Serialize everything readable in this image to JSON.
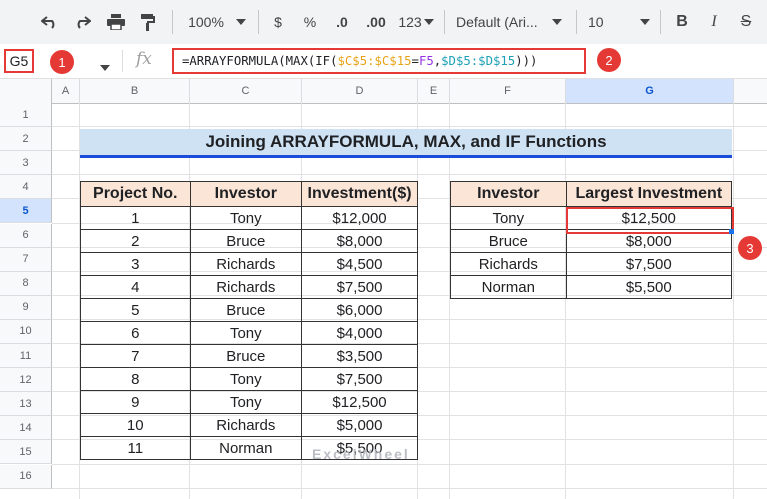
{
  "toolbar": {
    "zoom": "100%",
    "currency": "$",
    "percent": "%",
    "decrease_decimals": ".0",
    "increase_decimals": ".00",
    "more_formats": "123",
    "font": "Default (Ari...",
    "font_size": "10",
    "bold": "B",
    "italic": "I",
    "strikethrough": "S"
  },
  "formula_bar": {
    "cell_ref": "G5",
    "fx": "fx",
    "formula_parts": [
      {
        "text": "=ARRAYFORMULA(MAX(IF(",
        "color": "#202124"
      },
      {
        "text": "$C$5:$C$15",
        "color": "#e8a317"
      },
      {
        "text": "=",
        "color": "#202124"
      },
      {
        "text": "F5",
        "color": "#9334e6"
      },
      {
        "text": ",",
        "color": "#202124"
      },
      {
        "text": "$D$5:$D$15",
        "color": "#1ea0b5"
      },
      {
        "text": ")))",
        "color": "#202124"
      }
    ]
  },
  "badges": [
    "1",
    "2",
    "3"
  ],
  "columns": [
    "A",
    "B",
    "C",
    "D",
    "E",
    "F",
    "G"
  ],
  "rows": [
    "1",
    "2",
    "3",
    "4",
    "5",
    "6",
    "7",
    "8",
    "9",
    "10",
    "11",
    "12",
    "13",
    "14",
    "15",
    "16"
  ],
  "title": "Joining ARRAYFORMULA, MAX, and IF Functions",
  "main_table": {
    "headers": [
      "Project No.",
      "Investor",
      "Investment($)"
    ],
    "rows": [
      [
        "1",
        "Tony",
        "$12,000"
      ],
      [
        "2",
        "Bruce",
        "$8,000"
      ],
      [
        "3",
        "Richards",
        "$4,500"
      ],
      [
        "4",
        "Richards",
        "$7,500"
      ],
      [
        "5",
        "Bruce",
        "$6,000"
      ],
      [
        "6",
        "Tony",
        "$4,000"
      ],
      [
        "7",
        "Bruce",
        "$3,500"
      ],
      [
        "8",
        "Tony",
        "$7,500"
      ],
      [
        "9",
        "Tony",
        "$12,500"
      ],
      [
        "10",
        "Richards",
        "$5,000"
      ],
      [
        "11",
        "Norman",
        "$5,500"
      ]
    ]
  },
  "result_table": {
    "headers": [
      "Investor",
      "Largest Investment"
    ],
    "rows": [
      [
        "Tony",
        "$12,500"
      ],
      [
        "Bruce",
        "$8,000"
      ],
      [
        "Richards",
        "$7,500"
      ],
      [
        "Norman",
        "$5,500"
      ]
    ]
  },
  "watermark": "ExcelWheel"
}
